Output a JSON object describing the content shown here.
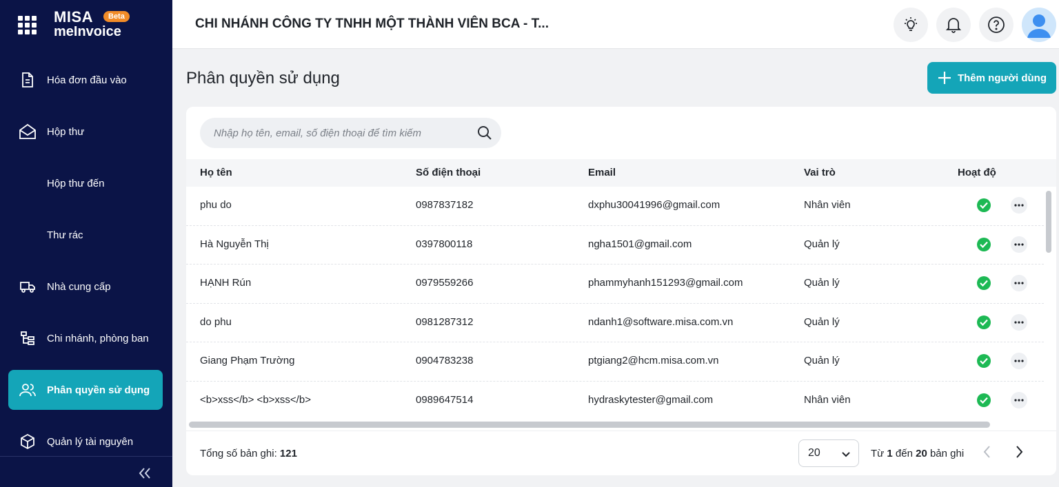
{
  "brand": {
    "logo_top": "MISA",
    "logo_bottom": "meInvoice",
    "badge": "Beta"
  },
  "sidebar": {
    "items": [
      {
        "label": "Hóa đơn đầu vào",
        "icon": "invoice-icon"
      },
      {
        "label": "Hộp thư",
        "icon": "mail-icon"
      },
      {
        "label": "Hộp thư đến",
        "icon": ""
      },
      {
        "label": "Thư rác",
        "icon": ""
      },
      {
        "label": "Nhà cung cấp",
        "icon": "delivery-truck-icon"
      },
      {
        "label": "Chi nhánh, phòng ban",
        "icon": "org-tree-icon"
      },
      {
        "label": "Phân quyền sử dụng",
        "icon": "users-icon",
        "active": true
      },
      {
        "label": "Quản lý tài nguyên",
        "icon": "box-icon"
      }
    ]
  },
  "header": {
    "company": "CHI NHÁNH CÔNG TY TNHH MỘT THÀNH VIÊN BCA - T..."
  },
  "page": {
    "title": "Phân quyền sử dụng",
    "add_button": "Thêm người dùng"
  },
  "search": {
    "placeholder": "Nhập họ tên, email, số điện thoại để tìm kiếm"
  },
  "table": {
    "columns": [
      "Họ tên",
      "Số điện thoại",
      "Email",
      "Vai trò",
      "Hoạt độ"
    ],
    "rows": [
      {
        "name": "phu do",
        "phone": "0987837182",
        "email": "dxphu30041996@gmail.com",
        "role": "Nhân viên",
        "active": true
      },
      {
        "name": "Hà Nguyễn Thị",
        "phone": "0397800118",
        "email": "ngha1501@gmail.com",
        "role": "Quản lý",
        "active": true
      },
      {
        "name": "HẠNH Rún",
        "phone": "0979559266",
        "email": "phammyhanh151293@gmail.com",
        "role": "Quản lý",
        "active": true
      },
      {
        "name": "do phu",
        "phone": "0981287312",
        "email": "ndanh1@software.misa.com.vn",
        "role": "Quản lý",
        "active": true
      },
      {
        "name": "Giang Phạm Trường",
        "phone": "0904783238",
        "email": "ptgiang2@hcm.misa.com.vn",
        "role": "Quản lý",
        "active": true
      },
      {
        "name": "<b>xss</b> <b>xss</b>",
        "phone": "0989647514",
        "email": "hydraskytester@gmail.com",
        "role": "Nhân viên",
        "active": true
      }
    ]
  },
  "footer": {
    "total_label": "Tổng số bản ghi:",
    "total_value": "121",
    "page_size": "20",
    "range_from_label": "Từ",
    "range_from": "1",
    "range_to_label": "đến",
    "range_to": "20",
    "range_suffix": "bản ghi"
  },
  "colors": {
    "sidebar_bg": "#0b1447",
    "accent": "#14a5b8",
    "status_active": "#1db954"
  }
}
